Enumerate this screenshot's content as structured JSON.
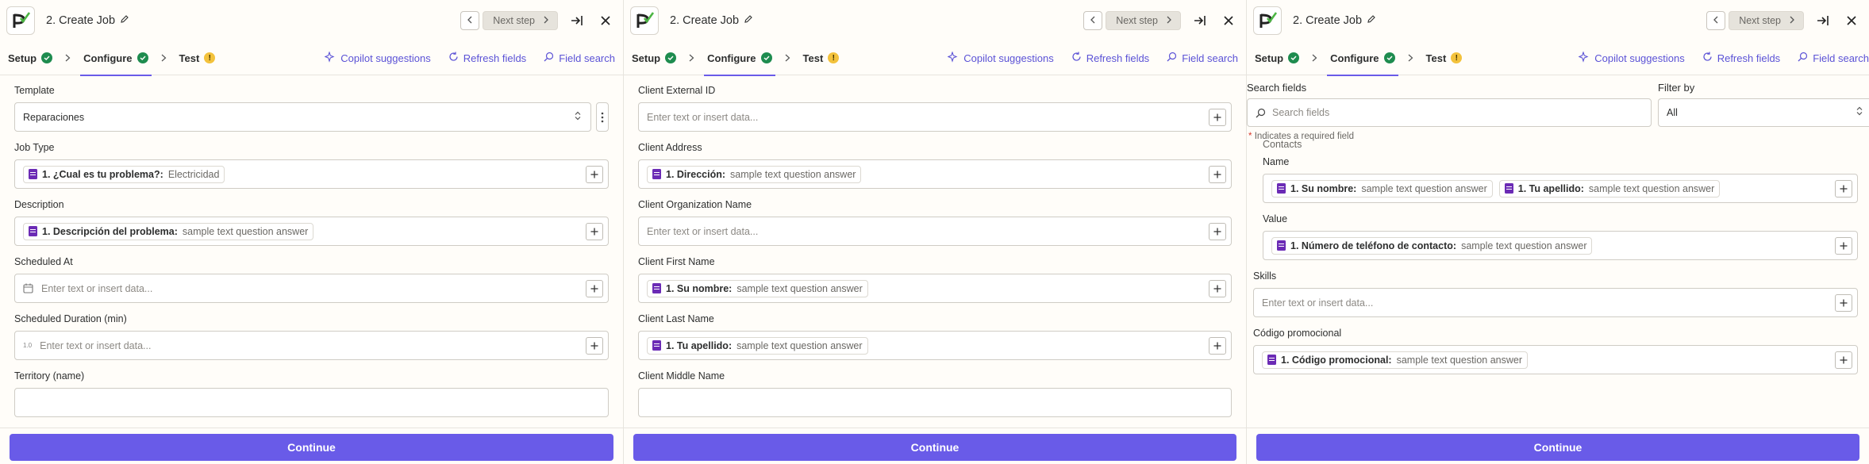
{
  "common": {
    "title": "2. Create Job",
    "next_step": "Next step",
    "tabs": {
      "setup": "Setup",
      "configure": "Configure",
      "test": "Test"
    },
    "tools": {
      "copilot": "Copilot suggestions",
      "refresh": "Refresh fields",
      "field_search": "Field search"
    },
    "placeholder": "Enter text or insert data...",
    "continue": "Continue",
    "warn_mark": "!",
    "colors": {
      "accent": "#695be8",
      "success": "#1e8c4f",
      "warning": "#f3c23c",
      "form_icon": "#6b2bb5"
    }
  },
  "panel1": {
    "template_label": "Template",
    "template_value": "Reparaciones",
    "job_type_label": "Job Type",
    "job_type_chip": {
      "key": "1. ¿Cual es tu problema?:",
      "value": "Electricidad"
    },
    "description_label": "Description",
    "description_chip": {
      "key": "1. Descripción del problema:",
      "value": "sample text question answer"
    },
    "scheduled_at_label": "Scheduled At",
    "scheduled_duration_label": "Scheduled Duration (min)",
    "number_icon_text": "1.0",
    "territory_label": "Territory (name)"
  },
  "panel2": {
    "client_external_id_label": "Client External ID",
    "client_address_label": "Client Address",
    "client_address_chip": {
      "key": "1. Dirección:",
      "value": "sample text question answer"
    },
    "client_org_label": "Client Organization Name",
    "client_first_label": "Client First Name",
    "client_first_chip": {
      "key": "1. Su nombre:",
      "value": "sample text question answer"
    },
    "client_last_label": "Client Last Name",
    "client_last_chip": {
      "key": "1. Tu apellido:",
      "value": "sample text question answer"
    },
    "client_middle_label": "Client Middle Name"
  },
  "panel3": {
    "search_label": "Search fields",
    "search_placeholder": "Search fields",
    "filter_label": "Filter by",
    "filter_value": "All",
    "required_note_star": "*",
    "required_note": "Indicates a required field",
    "contacts_section": "Contacts",
    "name_label": "Name",
    "name_chip1": {
      "key": "1. Su nombre:",
      "value": "sample text question answer"
    },
    "name_chip2": {
      "key": "1. Tu apellido:",
      "value": "sample text question answer"
    },
    "value_label": "Value",
    "value_chip": {
      "key": "1. Número de teléfono de contacto:",
      "value": "sample text question answer"
    },
    "skills_label": "Skills",
    "promo_label": "Código promocional",
    "promo_chip": {
      "key": "1. Código promocional:",
      "value": "sample text question answer"
    }
  }
}
